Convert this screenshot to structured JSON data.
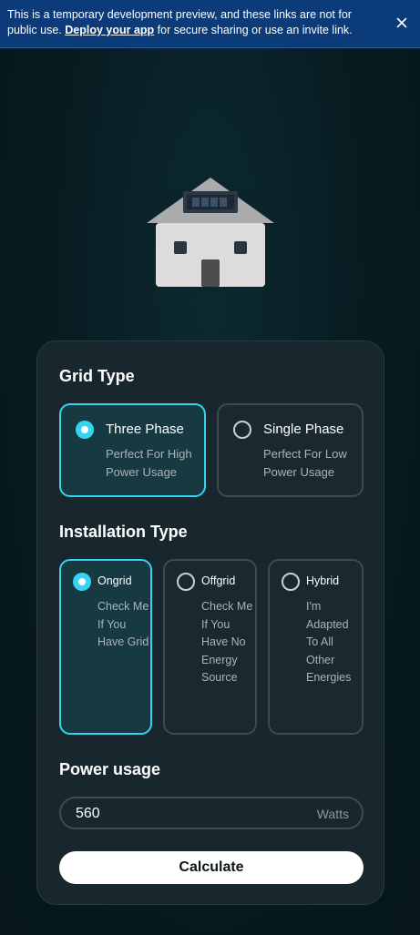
{
  "banner": {
    "text_before": "This is a temporary development preview, and these links are not for public use. ",
    "link_label": "Deploy your app",
    "text_after": " for secure sharing or use an invite link.",
    "close_icon": "close-icon"
  },
  "illustration": {
    "icon": "house-with-solar-panel-icon"
  },
  "grid_type": {
    "title": "Grid Type",
    "options": [
      {
        "label": "Three Phase",
        "description": "Perfect For High Power Usage",
        "selected": true
      },
      {
        "label": "Single Phase",
        "description": "Perfect For Low Power Usage",
        "selected": false
      }
    ]
  },
  "installation_type": {
    "title": "Installation Type",
    "options": [
      {
        "label": "Ongrid",
        "description": "Check Me If You Have Grid",
        "selected": true
      },
      {
        "label": "Offgrid",
        "description": "Check Me If You Have No Energy Source",
        "selected": false
      },
      {
        "label": "Hybrid",
        "description": "I'm Adapted To All Other Energies",
        "selected": false
      }
    ]
  },
  "power_usage": {
    "title": "Power usage",
    "value": "560",
    "unit": "Watts"
  },
  "calculate_button": {
    "label": "Calculate"
  },
  "colors": {
    "accent": "#35d5f2",
    "banner": "#0c3b7a",
    "card": "#17272d",
    "background": "#071b20"
  }
}
